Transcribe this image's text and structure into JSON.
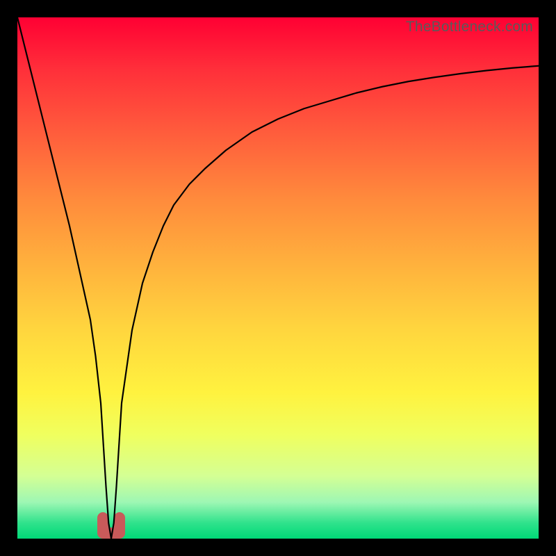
{
  "watermark": "TheBottleneck.com",
  "chart_data": {
    "type": "line",
    "title": "",
    "xlabel": "",
    "ylabel": "",
    "xlim": [
      0,
      100
    ],
    "ylim": [
      0,
      100
    ],
    "grid": false,
    "legend": false,
    "series": [
      {
        "name": "bottleneck-curve",
        "x": [
          0,
          2,
          4,
          6,
          8,
          10,
          12,
          14,
          15,
          16,
          16.5,
          17,
          17.5,
          18,
          18.5,
          19,
          19.5,
          20,
          22,
          24,
          26,
          28,
          30,
          33,
          36,
          40,
          45,
          50,
          55,
          60,
          65,
          70,
          75,
          80,
          85,
          90,
          95,
          100
        ],
        "values": [
          100,
          92,
          84,
          76,
          68,
          60,
          51,
          42,
          35,
          26,
          18,
          10,
          3,
          0,
          3,
          10,
          18,
          26,
          40,
          49,
          55,
          60,
          64,
          68,
          71,
          74.5,
          78,
          80.5,
          82.5,
          84,
          85.5,
          86.7,
          87.7,
          88.5,
          89.2,
          89.8,
          90.3,
          90.7
        ]
      }
    ],
    "marker": {
      "name": "min-point-marker",
      "x_center": 18,
      "x_half_width": 1.6,
      "y_bottom": 0,
      "y_top": 4,
      "color": "#c85a5a",
      "stroke_width": 16
    }
  }
}
